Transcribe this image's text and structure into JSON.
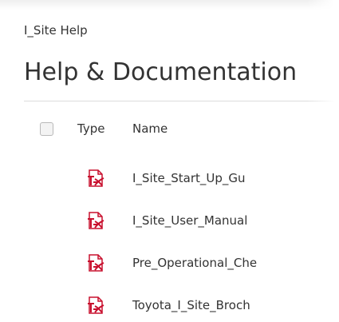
{
  "breadcrumb": "I_Site Help",
  "page_title": "Help & Documentation",
  "table": {
    "columns": {
      "type": "Type",
      "name": "Name"
    },
    "rows": [
      {
        "type_icon": "pdf-icon",
        "name": "I_Site_Start_Up_Gu"
      },
      {
        "type_icon": "pdf-icon",
        "name": "I_Site_User_Manual"
      },
      {
        "type_icon": "pdf-icon",
        "name": "Pre_Operational_Che"
      },
      {
        "type_icon": "pdf-icon",
        "name": "Toyota_I_Site_Broch"
      }
    ]
  },
  "colors": {
    "pdf_icon": "#c8102e",
    "divider": "#dcdcdc",
    "text": "#333333"
  }
}
